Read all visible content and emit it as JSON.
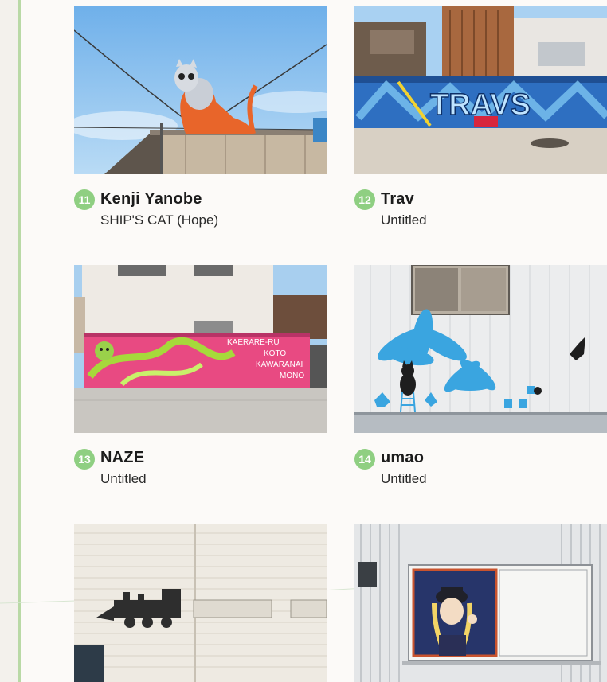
{
  "entries": [
    {
      "number": "11",
      "artist": "Kenji Yanobe",
      "work": "SHIP'S CAT (Hope)"
    },
    {
      "number": "12",
      "artist": "Trav",
      "work": "Untitled"
    },
    {
      "number": "13",
      "artist": "NAZE",
      "work": "Untitled"
    },
    {
      "number": "14",
      "artist": "umao",
      "work": "Untitled"
    }
  ],
  "mural_texts": {
    "trav_tag": "TRAVS",
    "naze_text_1": "KAERARE-RU",
    "naze_text_2": "KOTO",
    "naze_text_3": "KAWARANAI",
    "naze_text_4": "MONO"
  },
  "colors": {
    "badge": "#8fcf82",
    "rule": "#b9d9a6",
    "background": "#fcfaf8"
  }
}
